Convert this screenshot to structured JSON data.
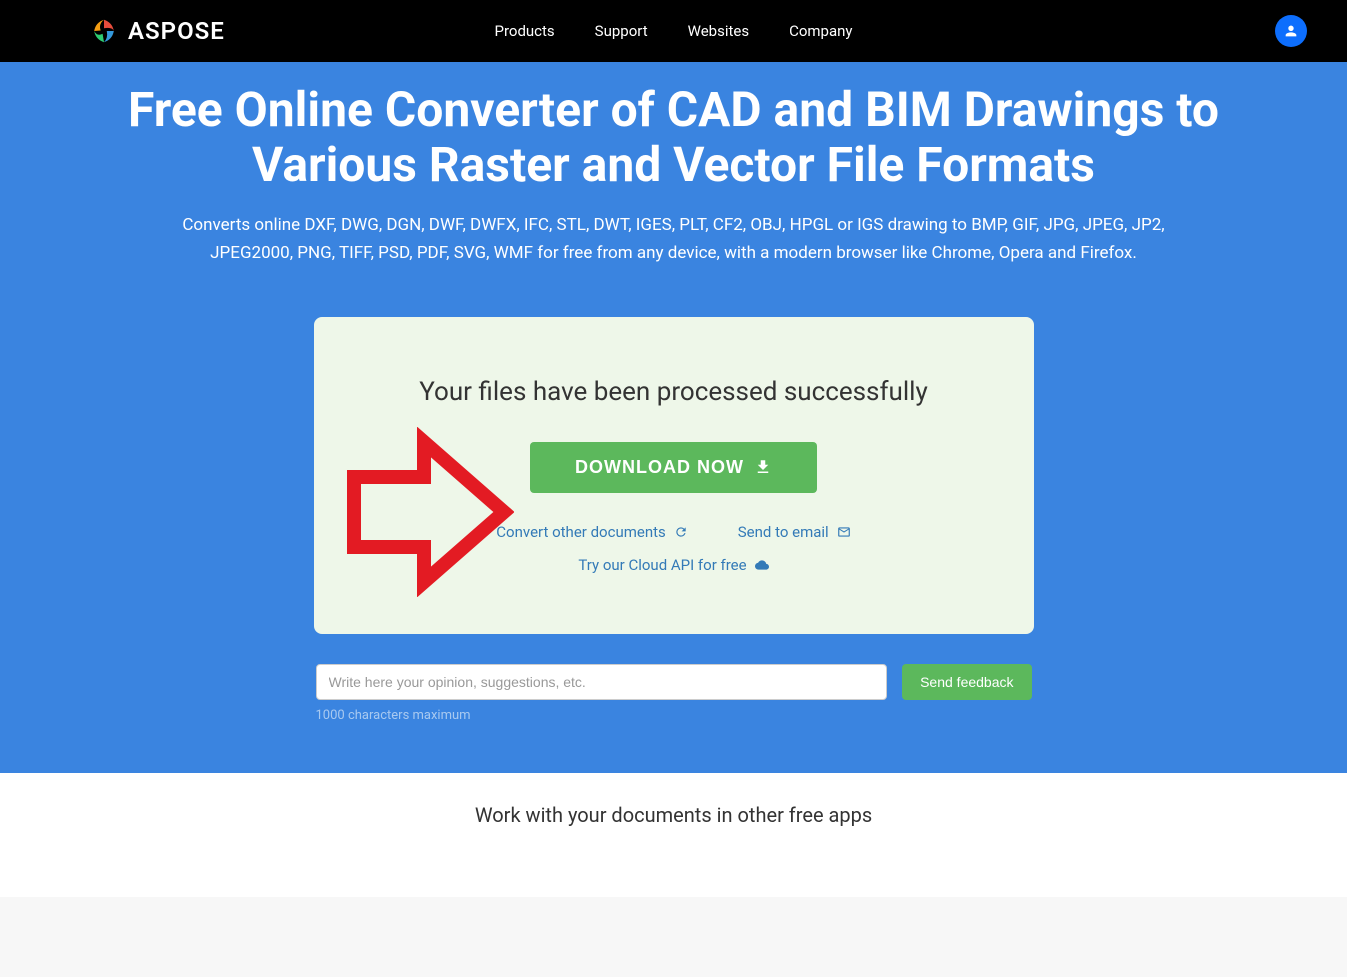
{
  "header": {
    "brand": "ASPOSE",
    "nav": {
      "products": "Products",
      "support": "Support",
      "websites": "Websites",
      "company": "Company"
    }
  },
  "hero": {
    "title": "Free Online Converter of CAD and BIM Drawings to Various Raster and Vector File Formats",
    "description": "Converts online DXF, DWG, DGN, DWF, DWFX, IFC, STL, DWT, IGES, PLT, CF2, OBJ, HPGL or IGS drawing to BMP, GIF, JPG, JPEG, JP2, JPEG2000, PNG, TIFF, PSD, PDF, SVG, WMF for free from any device, with a modern browser like Chrome, Opera and Firefox."
  },
  "success": {
    "title": "Your files have been processed successfully",
    "download_label": "DOWNLOAD NOW",
    "links": {
      "convert_other": "Convert other documents",
      "send_email": "Send to email",
      "cloud_api": "Try our Cloud API for free"
    }
  },
  "feedback": {
    "placeholder": "Write here your opinion, suggestions, etc.",
    "button": "Send feedback",
    "note": "1000 characters maximum"
  },
  "other_apps": {
    "title": "Work with your documents in other free apps"
  }
}
